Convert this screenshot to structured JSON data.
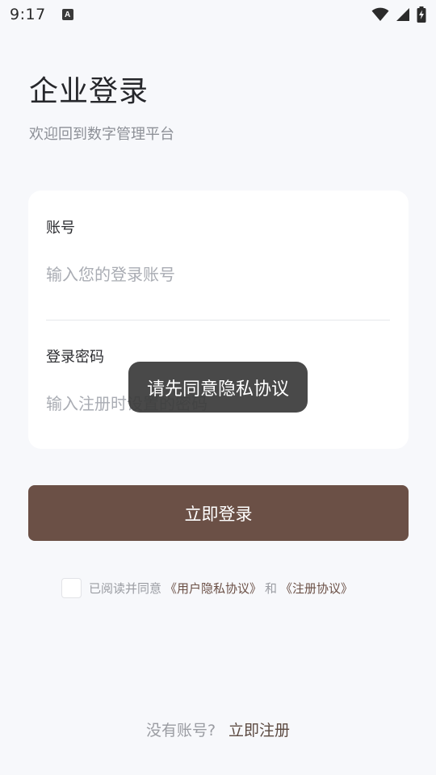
{
  "status_bar": {
    "time": "9:17",
    "notification_icon_letter": "A",
    "icons": [
      "wifi-icon",
      "signal-icon",
      "battery-charging-icon"
    ]
  },
  "header": {
    "title": "企业登录",
    "subtitle": "欢迎回到数字管理平台"
  },
  "form": {
    "account_label": "账号",
    "account_placeholder": "输入您的登录账号",
    "account_value": "",
    "password_label": "登录密码",
    "password_placeholder": "输入注册时设置的密码",
    "password_value": ""
  },
  "toast": {
    "message": "请先同意隐私协议"
  },
  "login_button_label": "立即登录",
  "agreement": {
    "checked": false,
    "prefix": "已阅读并同意",
    "privacy_link": "《用户隐私协议》",
    "conjunction": "和",
    "register_link": "《注册协议》"
  },
  "footer": {
    "no_account_text": "没有账号?",
    "register_link": "立即注册"
  },
  "colors": {
    "primary": "#6B5046",
    "background": "#F7F8FB",
    "toast_bg": "#3A3A3A"
  }
}
